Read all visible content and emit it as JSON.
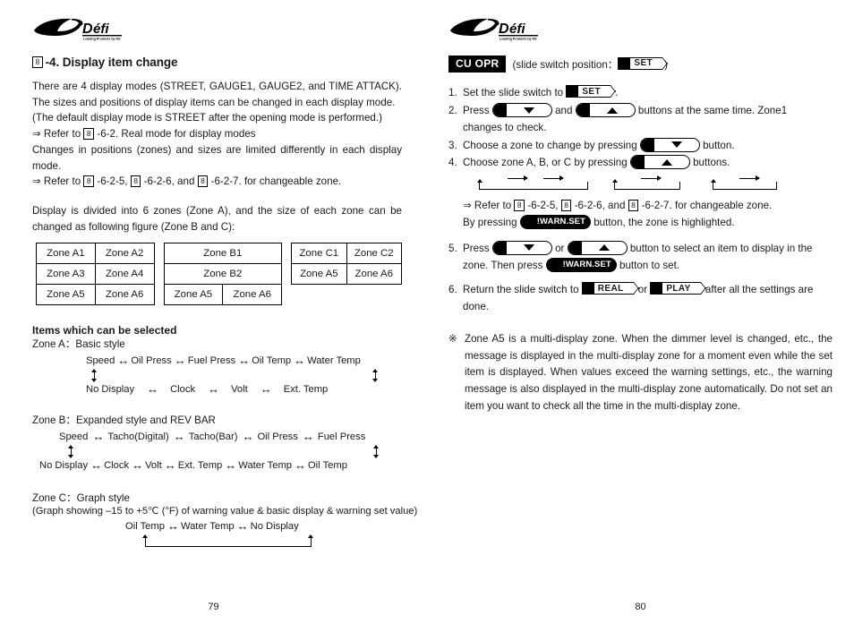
{
  "brand": {
    "logo_text": "Defi",
    "logo_tagline": "Leading Products by NS"
  },
  "left_page": {
    "page_number": "79",
    "section_marker": "8",
    "section_title": "-4. Display item change",
    "paragraphs": [
      "There are 4 display modes (STREET, GAUGE1, GAUGE2, and TIME ATTACK).  The sizes and positions of display items can be changed in each display mode.",
      "(The default display mode is STREET after the opening mode is performed.)"
    ],
    "refs": [
      {
        "prefix": "⇒ Refer to ",
        "marker": "8",
        "suffix": " -6-2. Real mode for display modes"
      }
    ],
    "paragraph2": "Changes in positions (zones) and sizes are limited differently in each display mode.",
    "ref2": {
      "prefix": "⇒ Refer to ",
      "m1": "8",
      "t1": " -6-2-5, ",
      "m2": "8",
      "t2": " -6-2-6, and ",
      "m3": "8",
      "t3": " -6-2-7. for changeable zone."
    },
    "paragraph3": "Display is divided into 6 zones (Zone A), and the size of each zone can be changed as following figure (Zone B and C):",
    "tables": {
      "zone_a": [
        [
          "Zone A1",
          "Zone A2"
        ],
        [
          "Zone A3",
          "Zone A4"
        ],
        [
          "Zone A5",
          "Zone A6"
        ]
      ],
      "zone_b": {
        "row1": "Zone B1",
        "row2": "Zone B2",
        "row3": [
          "Zone A5",
          "Zone A6"
        ]
      },
      "zone_c": {
        "left": "Zone C1",
        "right": "Zone C2",
        "row3": [
          "Zone A5",
          "Zone A6"
        ]
      }
    },
    "items_heading": "Items which can be selected",
    "zone_a_diagram": {
      "label": "Zone A：Basic style",
      "top_row": [
        "Speed",
        "Oil Press",
        "Fuel Press",
        "Oil Temp",
        "Water Temp"
      ],
      "bottom_row": [
        "No Display",
        "Clock",
        "Volt",
        "Ext. Temp"
      ]
    },
    "zone_b_diagram": {
      "label": "Zone B：Expanded style and REV BAR",
      "top_row": [
        "Speed",
        "Tacho(Digital)",
        "Tacho(Bar)",
        "Oil Press",
        "Fuel Press"
      ],
      "bottom_row": [
        "No Display",
        "Clock",
        "Volt",
        "Ext. Temp",
        "Water Temp",
        "Oil Temp"
      ]
    },
    "zone_c_diagram": {
      "label": "Zone C：Graph style",
      "sublabel": "(Graph showing –15 to +5℃ (°F) of warning value & basic display & warning set value)",
      "row": [
        "Oil Temp",
        "Water Temp",
        "No Display"
      ]
    }
  },
  "right_page": {
    "page_number": "80",
    "badge": "CU OPR",
    "header_note_prefix": "(slide switch position：",
    "header_note_suffix": ")",
    "switch_set": "SET",
    "switch_real": "REAL",
    "switch_play": "PLAY",
    "warn_button": "!WARN.SET",
    "steps": [
      {
        "num": "1.",
        "parts": [
          "Set the slide switch to ",
          "SET",
          " ."
        ]
      },
      {
        "num": "2.",
        "parts": [
          "Press ",
          "down",
          " and ",
          "up",
          " buttons at the same time.  Zone1"
        ],
        "cont": "changes to check."
      },
      {
        "num": "3.",
        "parts": [
          "Choose a zone to change by pressing ",
          "down",
          " button."
        ]
      },
      {
        "num": "4.",
        "parts": [
          "Choose zone A, B, or C by pressing ",
          "up",
          " buttons."
        ]
      },
      {
        "num": "5.",
        "parts": [
          "Press ",
          "down",
          " or ",
          "up",
          " button to select an item to display in the"
        ],
        "cont_parts": [
          "zone. Then press ",
          "warn",
          " button to set."
        ]
      },
      {
        "num": "6.",
        "parts": [
          "Return the slide switch to ",
          "REAL",
          " or ",
          "PLAY",
          " after all the settings are"
        ],
        "cont": "done."
      }
    ],
    "ref_line": {
      "prefix": "⇒ Refer to ",
      "m1": "8",
      "t1": " -6-2-5, ",
      "m2": "8",
      "t2": " -6-2-6, and ",
      "m3": "8",
      "t3": " -6-2-7. for changeable zone."
    },
    "warn_line": {
      "prefix": "By pressing ",
      "button": "!WARN.SET",
      "suffix": " button, the zone is highlighted."
    },
    "note_mark": "※",
    "note_text": "Zone A5 is a multi-display zone.  When the dimmer level is changed, etc., the message is displayed in the multi-display zone for a moment even while the set item is displayed.  When values exceed the warning settings, etc., the warning message is also displayed in the multi-display zone automatically.  Do not set an item you want to check all the time in the multi-display zone."
  }
}
